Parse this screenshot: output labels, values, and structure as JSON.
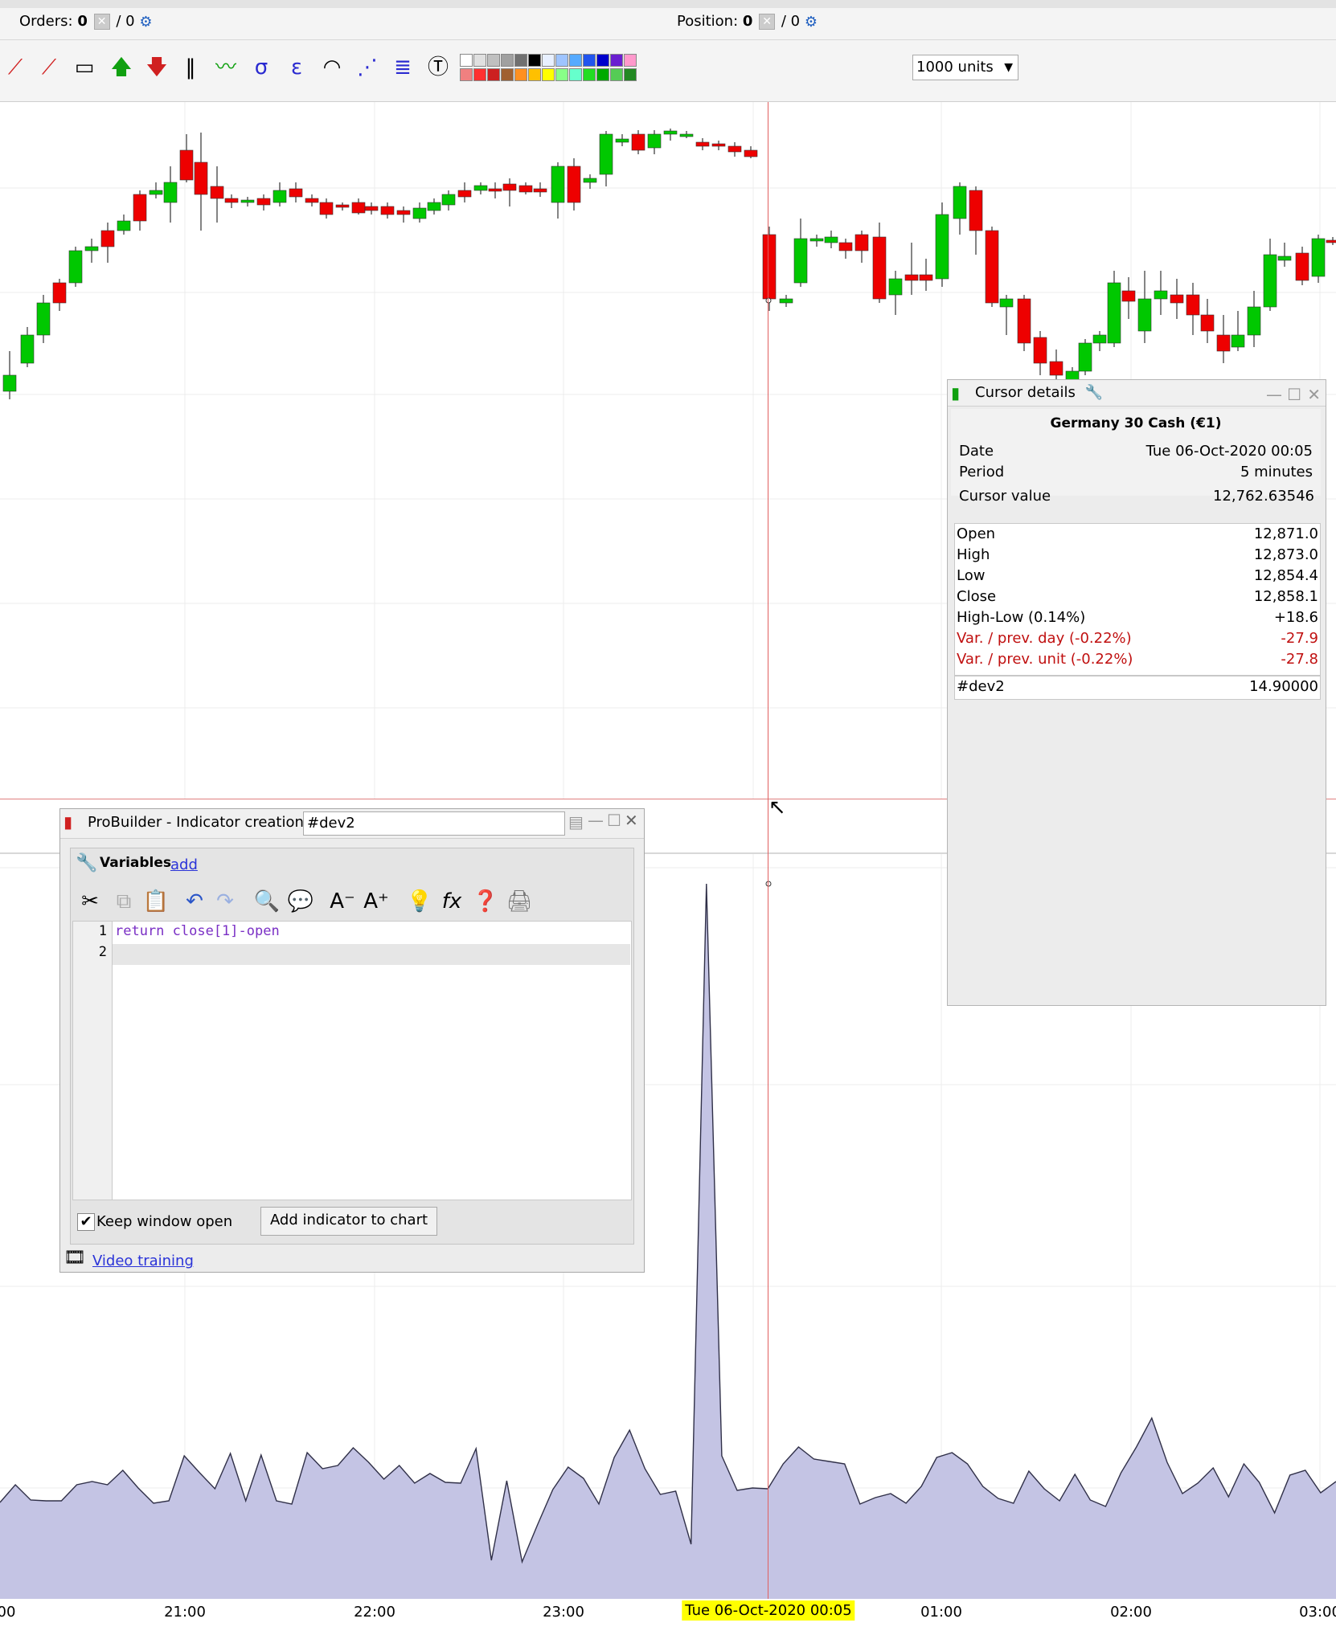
{
  "topbar": {
    "orders_label": "Orders:",
    "orders_value": "0",
    "orders_pending": "/ 0",
    "position_label": "Position:",
    "position_value": "0",
    "position_pending": "/ 0"
  },
  "toolbar": {
    "units": "1000 units",
    "tools": [
      "line-tool-icon",
      "channel-tool-icon",
      "rectangle-delete-icon",
      "buy-arrow-icon",
      "sell-arrow-icon",
      "vertical-lines-icon",
      "zigzag-icon",
      "sigma-channel-icon",
      "epsilon-channel-icon",
      "fan-icon",
      "gann-fan-icon",
      "fibonacci-icon",
      "text-icon"
    ],
    "palette_top": [
      "#ffffff",
      "#e0e0e0",
      "#c0c0c0",
      "#a0a0a0",
      "#707070",
      "#000000",
      "#e8f0ff",
      "#9ec4ff",
      "#55aaff",
      "#2255ee",
      "#0000cc",
      "#6a1fd0",
      "#ff99cc"
    ],
    "palette_bottom": [
      "#f08080",
      "#ff3030",
      "#cc2020",
      "#a06030",
      "#ff9020",
      "#ffc000",
      "#ffff00",
      "#88ff88",
      "#66ffcc",
      "#22dd22",
      "#00aa00",
      "#55cc55",
      "#228822"
    ]
  },
  "cursor_details": {
    "title": "Cursor details",
    "instrument": "Germany 30 Cash (€1)",
    "date_label": "Date",
    "date_value": "Tue 06-Oct-2020 00:05",
    "period_label": "Period",
    "period_value": "5 minutes",
    "cursor_label": "Cursor value",
    "cursor_value": "12,762.63546",
    "open_label": "Open",
    "open_value": "12,871.0",
    "high_label": "High",
    "high_value": "12,873.0",
    "low_label": "Low",
    "low_value": "12,854.4",
    "close_label": "Close",
    "close_value": "12,858.1",
    "hl_label": "High-Low (0.14%)",
    "hl_value": "+18.6",
    "varday_label": "Var. / prev. day (-0.22%)",
    "varday_value": "-27.9",
    "varunit_label": "Var. / prev. unit (-0.22%)",
    "varunit_value": "-27.8",
    "ind_label": "#dev2",
    "ind_value": "14.90000"
  },
  "probuilder": {
    "title": "ProBuilder - Indicator creation -",
    "name": "#dev2",
    "variables_label": "Variables",
    "add_link": "add",
    "code_line1": "return close[1]-open",
    "line1": "1",
    "line2": "2",
    "keep_open": "Keep window open",
    "add_button": "Add indicator to chart",
    "video_link": "Video training"
  },
  "axis": {
    "ticks": [
      "00",
      "21:00",
      "22:00",
      "23:00",
      "01:00",
      "02:00",
      "03:00"
    ],
    "cursor_date": "Tue 06-Oct-2020 00:05"
  },
  "colors": {
    "bull": "#00c800",
    "bear": "#ee0000",
    "area_fill": "#c4c4e4",
    "area_line": "#303048",
    "cursor_line": "#e06060"
  }
}
